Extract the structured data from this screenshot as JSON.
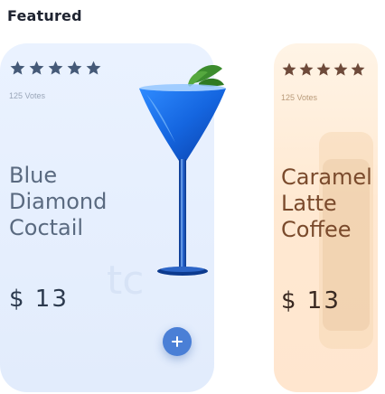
{
  "section": {
    "title": "Featured"
  },
  "cards": [
    {
      "rating": 5,
      "votes": "125 Votes",
      "name_lines": [
        "Blue",
        "Diamond",
        "Coctail"
      ],
      "price": "$ 13",
      "watermark": "tc",
      "colors": {
        "accent": "#4a7fd6",
        "star": "#455a78",
        "background": "#e6effd",
        "drink": "#1e6fe0"
      }
    },
    {
      "rating": 5,
      "votes": "125 Votes",
      "name_lines": [
        "Caramel",
        "Latte",
        "Coffee"
      ],
      "price": "$ 13",
      "colors": {
        "star": "#6e4a3a",
        "background": "#ffeedd"
      }
    }
  ],
  "icons": {
    "star": "star-icon",
    "add": "plus-icon"
  }
}
